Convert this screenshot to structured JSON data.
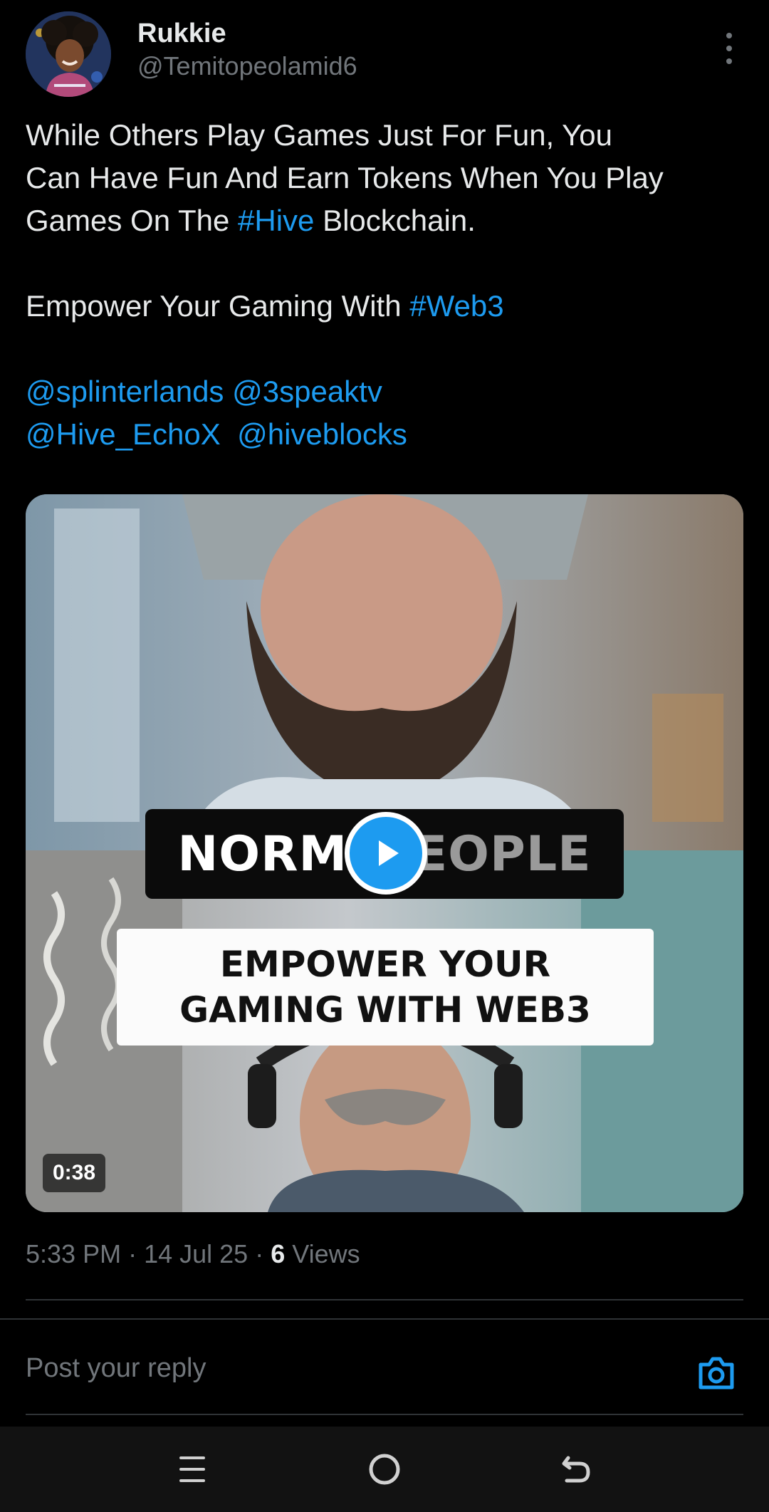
{
  "author": {
    "display_name": "Rukkie",
    "handle": "@Temitopeolamid6"
  },
  "tweet": {
    "line1": "While Others Play Games Just For Fun, You",
    "line2": "Can Have Fun And Earn Tokens When You Play",
    "line3_pre": "Games On The ",
    "hashtag_hive": "#Hive",
    "line3_post": " Blockchain.",
    "line4_pre": "Empower Your Gaming With ",
    "hashtag_web3": "#Web3",
    "mention_1": "@splinterlands",
    "mention_2": "@3speaktv",
    "mention_3": "@Hive_EchoX",
    "mention_4": "@hiveblocks"
  },
  "video": {
    "caption_dark_left": "NORMA",
    "caption_dark_right": "EOPLE",
    "caption_light_line1": "EMPOWER YOUR",
    "caption_light_line2": "GAMING WITH WEB3",
    "duration": "0:38"
  },
  "meta": {
    "time": "5:33 PM",
    "separator": " · ",
    "date": "14 Jul 25",
    "views_count": "6",
    "views_label": " Views"
  },
  "reply": {
    "placeholder": "Post your reply"
  },
  "colors": {
    "accent": "#1d9bf0",
    "background": "#000000",
    "text": "#e7e9ea",
    "muted": "#71767b"
  },
  "icons": {
    "more": "more-vertical-icon",
    "play": "play-icon",
    "camera": "camera-icon",
    "nav_recents": "recents-icon",
    "nav_home": "home-icon",
    "nav_back": "back-icon"
  }
}
